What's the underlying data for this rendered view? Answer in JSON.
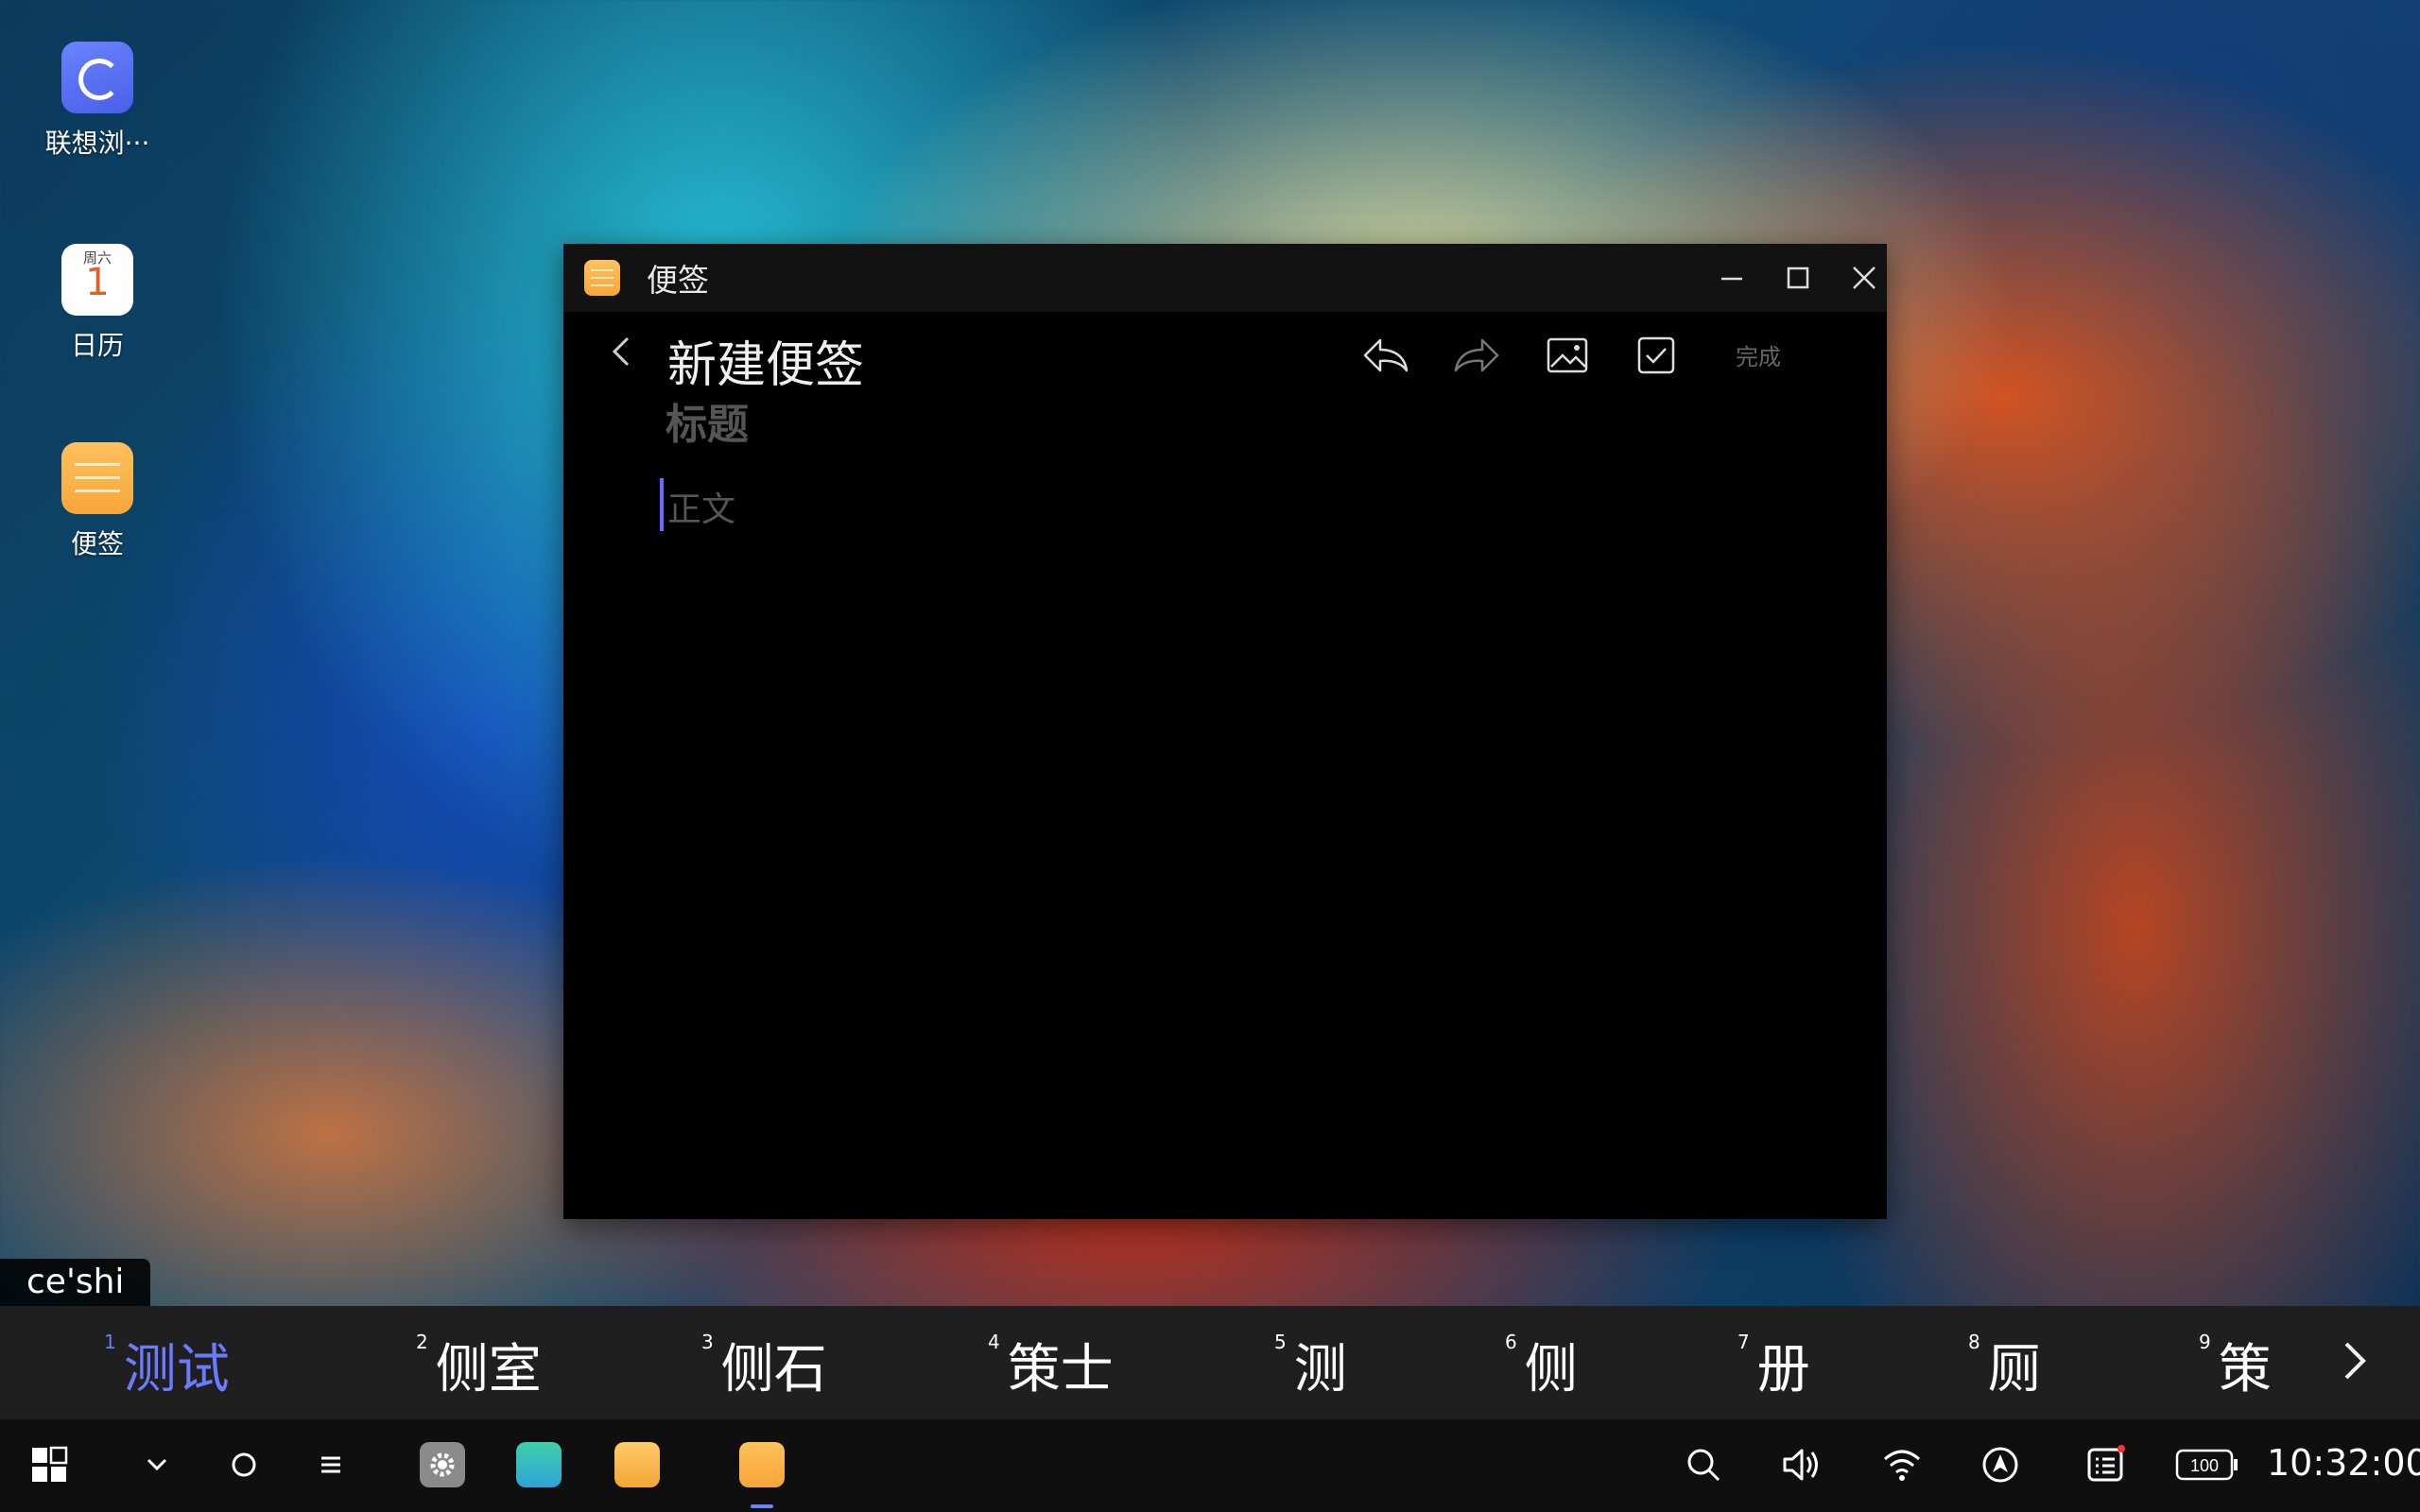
{
  "desktop": {
    "icons": [
      {
        "label": "联想浏···",
        "icon": "browser-icon"
      },
      {
        "label": "日历",
        "icon": "calendar-icon",
        "weekday": "周六",
        "day": "1"
      },
      {
        "label": "便签",
        "icon": "sticky-notes-icon"
      }
    ]
  },
  "window": {
    "title": "便签",
    "heading": "新建便签",
    "done_label": "完成",
    "title_placeholder": "标题",
    "body_placeholder": "正文"
  },
  "ime": {
    "pinyin": "ce'shi",
    "candidates": [
      {
        "index": "1",
        "text": "测试"
      },
      {
        "index": "2",
        "text": "侧室"
      },
      {
        "index": "3",
        "text": "侧石"
      },
      {
        "index": "4",
        "text": "策士"
      },
      {
        "index": "5",
        "text": "测"
      },
      {
        "index": "6",
        "text": "侧"
      },
      {
        "index": "7",
        "text": "册"
      },
      {
        "index": "8",
        "text": "厕"
      },
      {
        "index": "9",
        "text": "策"
      }
    ],
    "selected_color": "#6b7bff"
  },
  "taskbar": {
    "battery": "100",
    "clock": "10:32:00"
  },
  "colors": {
    "accent": "#6a84ff",
    "note_orange": "#f7a638"
  }
}
